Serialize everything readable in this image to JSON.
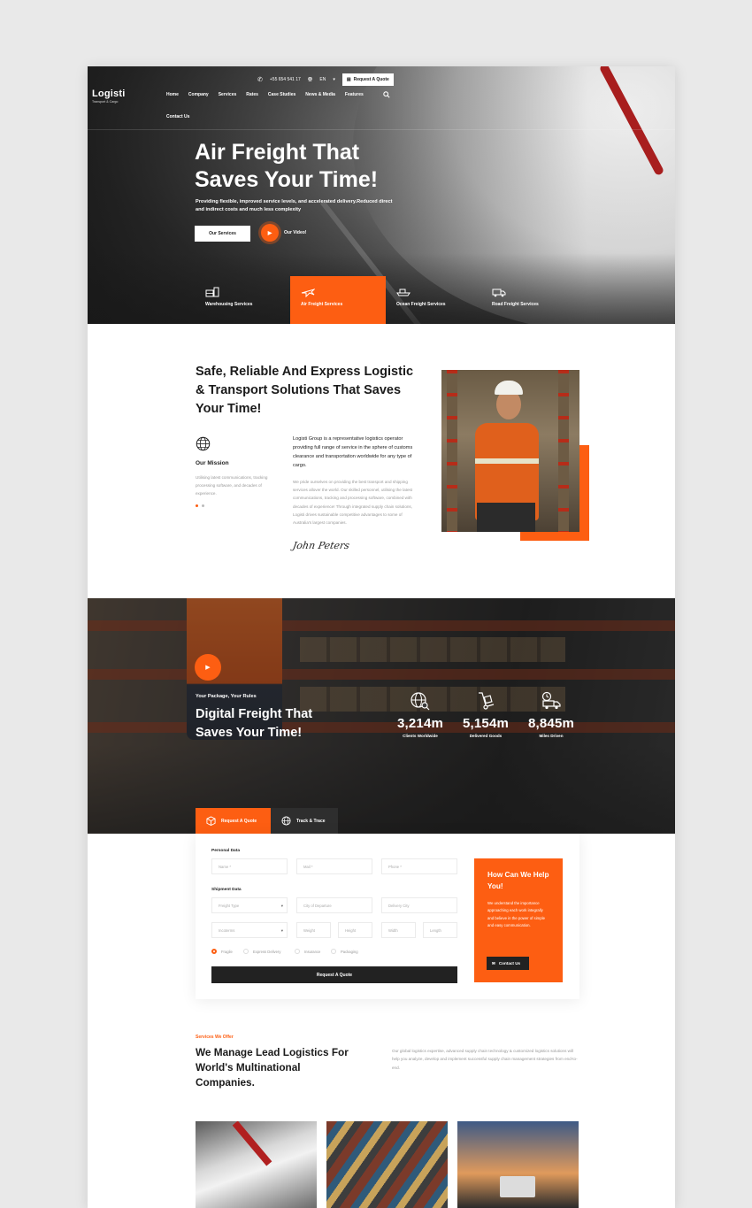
{
  "header": {
    "phone": "+55 654 541 17",
    "language": "EN",
    "quote_button": "Request A Quote",
    "logo_name": "Logisti",
    "logo_tagline": "Transport & Cargo",
    "nav": [
      "Home",
      "Company",
      "Services",
      "Rates",
      "Case Studies",
      "News & Media",
      "Features",
      "Contact Us"
    ]
  },
  "hero": {
    "title": "Air Freight That Saves Your Time!",
    "subtitle": "Providing flexible, improved service levels, and accelerated delivery.Reduced direct and indirect costs and much less complexity",
    "services_button": "Our Services",
    "video_button": "Our Video!",
    "service_tabs": [
      {
        "label": "Warehousing Services",
        "icon": "warehouse-icon",
        "active": false
      },
      {
        "label": "Air Freight Services",
        "icon": "plane-icon",
        "active": true
      },
      {
        "label": "Ocean Freight Services",
        "icon": "ship-icon",
        "active": false
      },
      {
        "label": "Road Freight Services",
        "icon": "truck-icon",
        "active": false
      }
    ]
  },
  "about": {
    "title": "Safe, Reliable And Express Logistic & Transport Solutions That Saves Your Time!",
    "mission_title": "Our Mission",
    "mission_text": "Utilising latest communications, tracking processing software, and decades of experience.",
    "lead": "Logisti Group is a representative logistics operator providing full range of service in the sphere of customs clearance and transportation worldwide for any type of cargo.",
    "body": "We pride ourselves on providing the best transport and shipping services allover the world. Our skilled personnel, utilising the latest communications, tracking and processing software, combined with decades of experience! Through integrated supply chain solutions, Logisti drives sustainable competitive advantages to some of Australia's largest companies.",
    "signature": "John Peters"
  },
  "stats_band": {
    "kicker": "Your Package, Your Rules",
    "title": "Digital Freight That Saves Your Time!",
    "stats": [
      {
        "value": "3,214m",
        "label": "Clients Worldwide",
        "icon": "globe-search-icon"
      },
      {
        "value": "5,154m",
        "label": "Delivered Goods",
        "icon": "hand-truck-icon"
      },
      {
        "value": "8,845m",
        "label": "Miles Driven",
        "icon": "delivery-truck-icon"
      }
    ]
  },
  "quote_form": {
    "tabs": [
      "Request A Quote",
      "Track & Trace"
    ],
    "personal_label": "Personal Data",
    "name_placeholder": "Name *",
    "mail_placeholder": "Mail *",
    "phone_placeholder": "Phone *",
    "shipment_label": "Shipment Data",
    "freight_type": "Freight Type",
    "city_departure": "City of Departure",
    "delivery_city": "Delivery City",
    "incoterms": "Incoterms",
    "weight": "Weight",
    "height": "Height",
    "width": "Width",
    "length": "Length",
    "options": [
      "Fragile",
      "Express Delivery",
      "Insurance",
      "Packaging"
    ],
    "selected_option": "Fragile",
    "submit": "Request A Quote",
    "help_title": "How Can We Help You!",
    "help_text": "We understand the importance approaching each work integrally and believe in the power of simple and easy communication.",
    "help_button": "Contact Us"
  },
  "services_offer": {
    "kicker": "Services We Offer",
    "title": "We Manage Lead Logistics For World's Multinational Companies.",
    "text": "Our global logistics expertise, advanced supply chain technology & customized logistics solutions will help you analyze, develop and implement successful supply chain management strategies from end-to-end."
  },
  "colors": {
    "accent": "#fd5e12",
    "dark": "#222222",
    "background": "#e9e9e9"
  }
}
